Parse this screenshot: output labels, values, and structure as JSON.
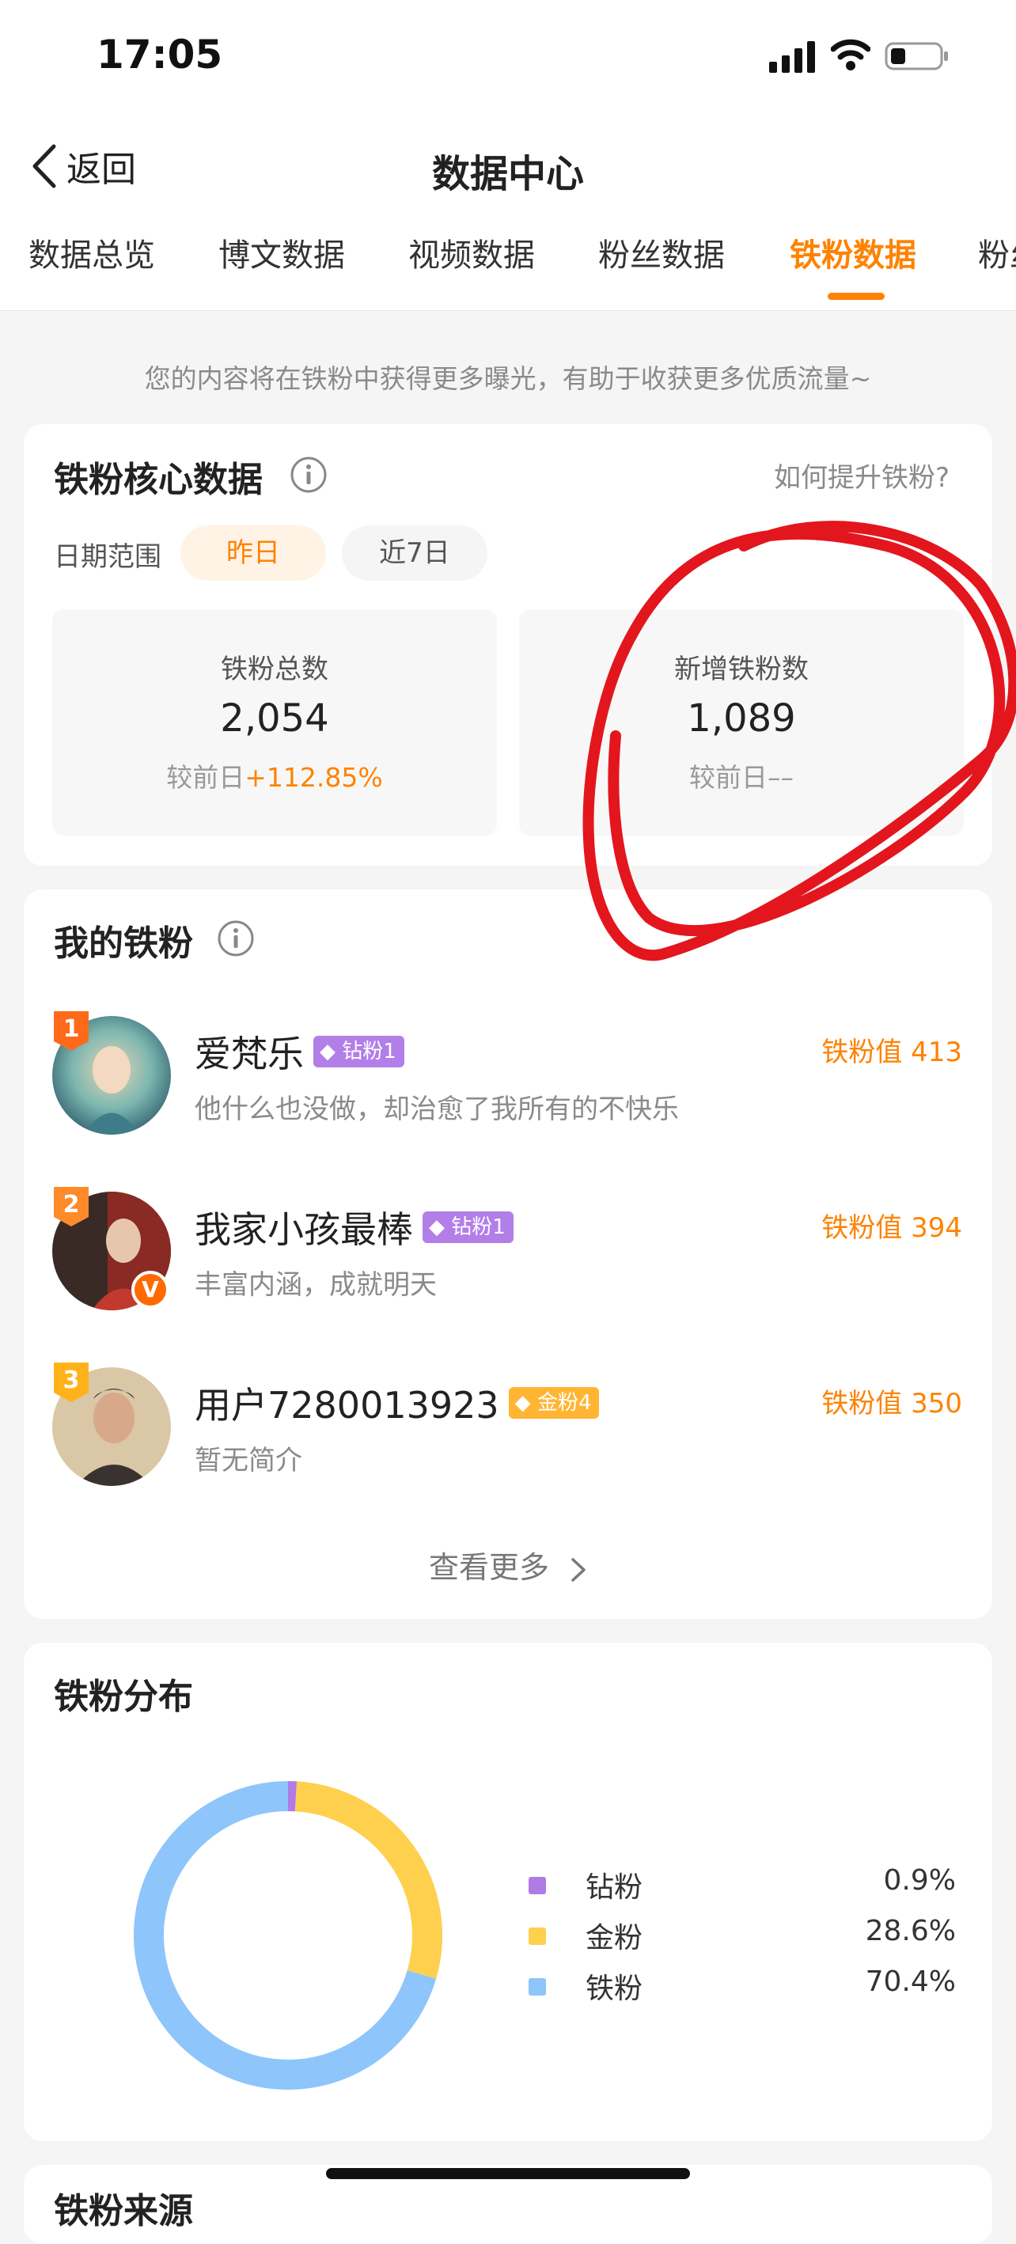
{
  "status_bar": {
    "time": "17:05"
  },
  "nav": {
    "back_label": "返回",
    "title": "数据中心"
  },
  "tabs": [
    {
      "label": "数据总览",
      "active": false
    },
    {
      "label": "博文数据",
      "active": false
    },
    {
      "label": "视频数据",
      "active": false
    },
    {
      "label": "粉丝数据",
      "active": false
    },
    {
      "label": "铁粉数据",
      "active": true
    },
    {
      "label": "粉丝",
      "active": false
    }
  ],
  "notice": "您的内容将在铁粉中获得更多曝光，有助于收获更多优质流量~",
  "core": {
    "title": "铁粉核心数据",
    "help_link": "如何提升铁粉?",
    "date_range_label": "日期范围",
    "range_options": [
      "昨日",
      "近7日"
    ],
    "selected_range": "昨日",
    "stats": [
      {
        "label": "铁粉总数",
        "value": "2,054",
        "compare_prefix": "较前日",
        "compare_value": "+112.85%"
      },
      {
        "label": "新增铁粉数",
        "value": "1,089",
        "compare_prefix": "较前日",
        "compare_value": "––"
      }
    ]
  },
  "my_fans": {
    "title": "我的铁粉",
    "items": [
      {
        "rank": "1",
        "name": "爱梵乐",
        "badge": "钻粉1",
        "badge_type": "diamond",
        "bio": "他什么也没做，却治愈了我所有的不快乐",
        "score": "铁粉值 413"
      },
      {
        "rank": "2",
        "name": "我家小孩最棒",
        "badge": "钻粉1",
        "badge_type": "diamond",
        "bio": "丰富内涵，成就明天",
        "score": "铁粉值 394"
      },
      {
        "rank": "3",
        "name": "用户7280013923",
        "badge": "金粉4",
        "badge_type": "gold",
        "bio": "暂无简介",
        "score": "铁粉值 350"
      }
    ],
    "more_label": "查看更多"
  },
  "distribution": {
    "title": "铁粉分布",
    "colors": {
      "diamond": "#b07be6",
      "gold": "#ffd04d",
      "iron": "#8ec5fb"
    }
  },
  "chart_data": {
    "type": "pie",
    "donut": true,
    "categories": [
      "钻粉",
      "金粉",
      "铁粉"
    ],
    "values": [
      0.9,
      28.6,
      70.4
    ],
    "value_labels": [
      "0.9%",
      "28.6%",
      "70.4%"
    ],
    "colors": [
      "#b07be6",
      "#ffd04d",
      "#8ec5fb"
    ],
    "legend": "right"
  },
  "next_section_title": "铁粉来源"
}
